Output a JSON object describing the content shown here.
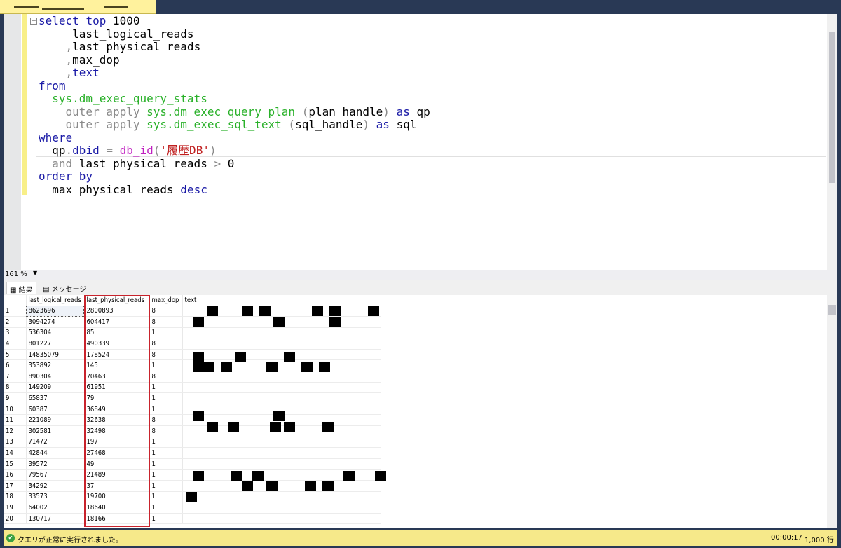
{
  "editor": {
    "lines": [
      [
        {
          "t": "select ",
          "c": "kw"
        },
        {
          "t": "top ",
          "c": "kw"
        },
        {
          "t": "1000",
          "c": ""
        }
      ],
      [
        {
          "t": "     last_logical_reads",
          "c": ""
        }
      ],
      [
        {
          "t": "    ,",
          "c": "gr"
        },
        {
          "t": "last_physical_reads",
          "c": ""
        }
      ],
      [
        {
          "t": "    ,",
          "c": "gr"
        },
        {
          "t": "max_dop",
          "c": ""
        }
      ],
      [
        {
          "t": "    ,",
          "c": "gr"
        },
        {
          "t": "text",
          "c": "kw"
        }
      ],
      [
        {
          "t": "from",
          "c": "kw"
        }
      ],
      [
        {
          "t": "  sys.dm_exec_query_stats",
          "c": "fn"
        }
      ],
      [
        {
          "t": "    outer apply ",
          "c": "gr"
        },
        {
          "t": "sys.dm_exec_query_plan ",
          "c": "fn"
        },
        {
          "t": "(",
          "c": "gr"
        },
        {
          "t": "plan_handle",
          "c": ""
        },
        {
          "t": ") ",
          "c": "gr"
        },
        {
          "t": "as ",
          "c": "kw"
        },
        {
          "t": "qp",
          "c": ""
        }
      ],
      [
        {
          "t": "    outer apply ",
          "c": "gr"
        },
        {
          "t": "sys.dm_exec_sql_text ",
          "c": "fn"
        },
        {
          "t": "(",
          "c": "gr"
        },
        {
          "t": "sql_handle",
          "c": ""
        },
        {
          "t": ") ",
          "c": "gr"
        },
        {
          "t": "as ",
          "c": "kw"
        },
        {
          "t": "sql",
          "c": ""
        }
      ],
      [
        {
          "t": "where",
          "c": "kw"
        }
      ],
      [
        {
          "t": "  qp",
          "c": ""
        },
        {
          "t": ".",
          "c": "gr"
        },
        {
          "t": "dbid ",
          "c": "kw"
        },
        {
          "t": "= ",
          "c": "gr"
        },
        {
          "t": "db_id",
          "c": "mg"
        },
        {
          "t": "(",
          "c": "gr"
        },
        {
          "t": "'履歴DB'",
          "c": "str"
        },
        {
          "t": ")",
          "c": "gr"
        }
      ],
      [
        {
          "t": "  and ",
          "c": "gr"
        },
        {
          "t": "last_physical_reads ",
          "c": ""
        },
        {
          "t": "> ",
          "c": "gr"
        },
        {
          "t": "0",
          "c": ""
        }
      ],
      [
        {
          "t": "order by",
          "c": "kw"
        }
      ],
      [
        {
          "t": "  max_physical_reads ",
          "c": ""
        },
        {
          "t": "desc",
          "c": "kw"
        }
      ]
    ]
  },
  "zoom": "161 %",
  "tabs": {
    "results": "結果",
    "messages": "メッセージ"
  },
  "grid": {
    "columns": [
      "last_logical_reads",
      "last_physical_reads",
      "max_dop",
      "text"
    ],
    "rows": [
      [
        "1",
        "8623696",
        "2800893",
        "8"
      ],
      [
        "2",
        "3094274",
        "604417",
        "8"
      ],
      [
        "3",
        "536304",
        "85",
        "1"
      ],
      [
        "4",
        "801227",
        "490339",
        "8"
      ],
      [
        "5",
        "14835079",
        "178524",
        "8"
      ],
      [
        "6",
        "353892",
        "145",
        "1"
      ],
      [
        "7",
        "890304",
        "70463",
        "8"
      ],
      [
        "8",
        "149209",
        "61951",
        "1"
      ],
      [
        "9",
        "65837",
        "79",
        "1"
      ],
      [
        "10",
        "60387",
        "36849",
        "1"
      ],
      [
        "11",
        "221089",
        "32638",
        "8"
      ],
      [
        "12",
        "302581",
        "32498",
        "8"
      ],
      [
        "13",
        "71472",
        "197",
        "1"
      ],
      [
        "14",
        "42844",
        "27468",
        "1"
      ],
      [
        "15",
        "39572",
        "49",
        "1"
      ],
      [
        "16",
        "79567",
        "21489",
        "1"
      ],
      [
        "17",
        "34292",
        "37",
        "1"
      ],
      [
        "18",
        "33573",
        "19700",
        "1"
      ],
      [
        "19",
        "64002",
        "18640",
        "1"
      ],
      [
        "20",
        "130717",
        "18166",
        "1"
      ]
    ],
    "highlight_color": "#c8232c"
  },
  "status": {
    "message": "クエリが正常に実行されました。",
    "elapsed": "00:00:17",
    "row_count": "1,000 行",
    "color": "#f6e98a"
  }
}
